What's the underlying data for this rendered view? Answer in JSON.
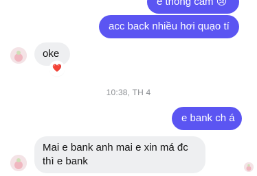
{
  "messages": [
    {
      "id": "m1",
      "direction": "outgoing",
      "text": "e thông cảm 😢"
    },
    {
      "id": "m2",
      "direction": "outgoing",
      "text": "acc back nhiều hơi quạo tí"
    },
    {
      "id": "m3",
      "direction": "incoming",
      "text": "oke",
      "reaction": "❤️"
    },
    {
      "id": "m4",
      "direction": "outgoing",
      "text": "e bank ch á"
    },
    {
      "id": "m5",
      "direction": "incoming",
      "text": "Mai e bank anh mai e xin má đc thì e bank",
      "lines": [
        "Mai e bank anh mai e xin má đc",
        "thì e bank"
      ]
    }
  ],
  "timestamp": "10:38, TH 4",
  "colors": {
    "outgoing_bubble": "#5b55f2",
    "incoming_bubble": "#eeeff1",
    "timestamp_text": "#8a8d91"
  },
  "icons": {
    "contact_avatar": "peach-avatar-icon",
    "reaction": "red-heart-emoji",
    "read_receipt": "seen-avatar-icon"
  }
}
